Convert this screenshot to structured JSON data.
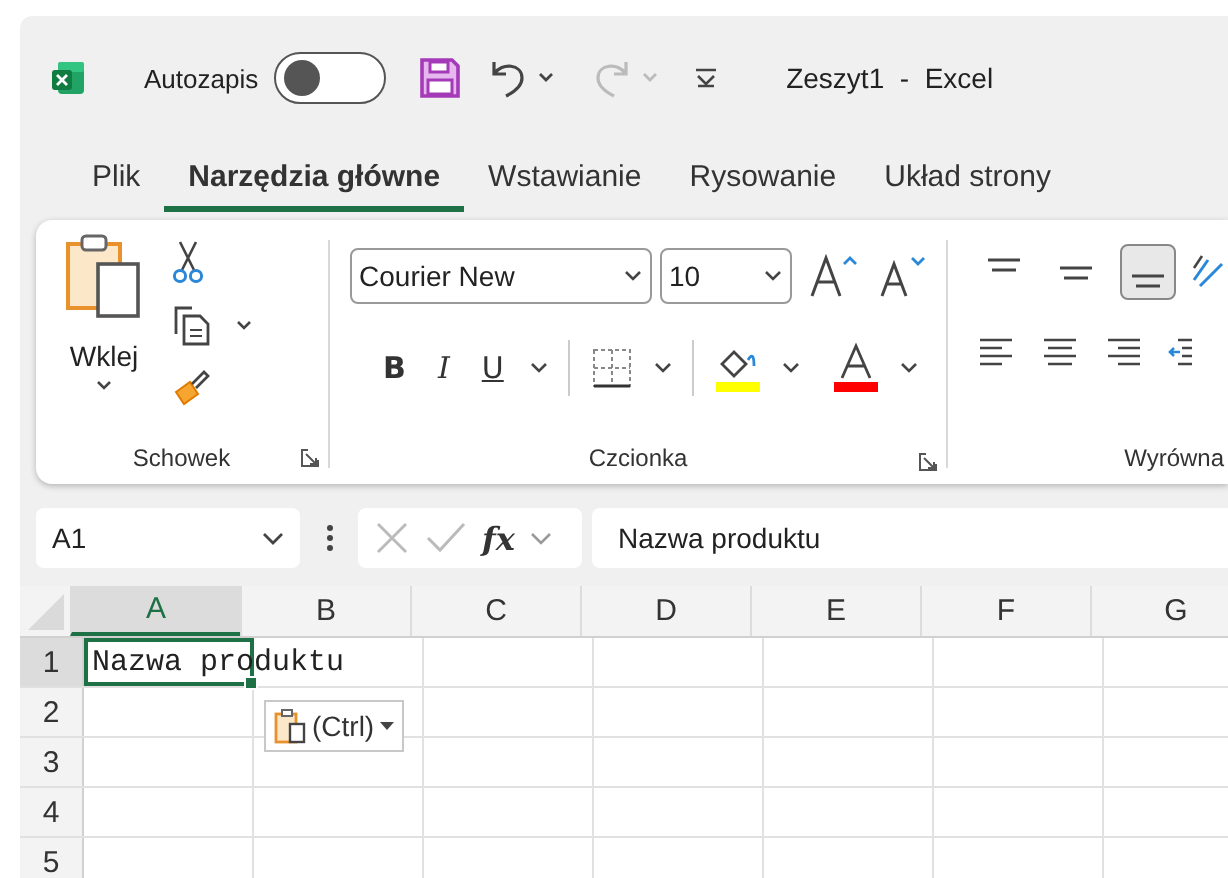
{
  "title_bar": {
    "autosave_label": "Autozapis",
    "autosave_on": false,
    "title": "Zeszyt1  -  Excel"
  },
  "tabs": [
    {
      "label": "Plik",
      "selected": false
    },
    {
      "label": "Narzędzia główne",
      "selected": true
    },
    {
      "label": "Wstawianie",
      "selected": false
    },
    {
      "label": "Rysowanie",
      "selected": false
    },
    {
      "label": "Układ strony",
      "selected": false
    }
  ],
  "ribbon": {
    "clipboard": {
      "paste_label": "Wklej",
      "group_label": "Schowek"
    },
    "font": {
      "font_name": "Courier New",
      "font_size": "10",
      "bold_label": "B",
      "italic_label": "I",
      "underline_label": "U",
      "group_label": "Czcionka"
    },
    "alignment": {
      "vertical_buttons": [
        {
          "kind": "top",
          "selected": false
        },
        {
          "kind": "middle",
          "selected": false
        },
        {
          "kind": "bottom",
          "selected": true
        }
      ],
      "group_label": "Wyrówna"
    }
  },
  "formula_bar": {
    "name_box": "A1",
    "fx_label": "fx",
    "value": "Nazwa produktu"
  },
  "sheet": {
    "columns": [
      {
        "label": "A",
        "selected": true
      },
      {
        "label": "B",
        "selected": false
      },
      {
        "label": "C",
        "selected": false
      },
      {
        "label": "D",
        "selected": false
      },
      {
        "label": "E",
        "selected": false
      },
      {
        "label": "F",
        "selected": false
      },
      {
        "label": "G",
        "selected": false
      }
    ],
    "rows": [
      {
        "label": "1",
        "selected": true,
        "cells": [
          "Nazwa produktu"
        ]
      },
      {
        "label": "2",
        "selected": false
      },
      {
        "label": "3",
        "selected": false
      },
      {
        "label": "4",
        "selected": false
      },
      {
        "label": "5",
        "selected": false
      }
    ],
    "paste_options_label": "(Ctrl)"
  }
}
